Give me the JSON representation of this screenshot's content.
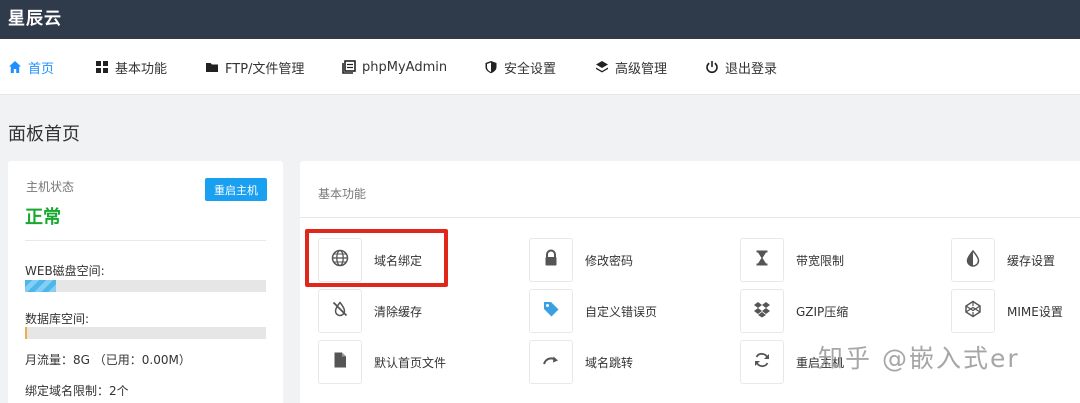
{
  "brand": "星辰云",
  "nav": {
    "items": [
      {
        "label": "首页",
        "icon": "home-icon",
        "active": true
      },
      {
        "label": "基本功能",
        "icon": "grid-icon"
      },
      {
        "label": "FTP/文件管理",
        "icon": "folder-icon"
      },
      {
        "label": "phpMyAdmin",
        "icon": "database-icon"
      },
      {
        "label": "安全设置",
        "icon": "shield-icon"
      },
      {
        "label": "高级管理",
        "icon": "layers-icon"
      },
      {
        "label": "退出登录",
        "icon": "power-icon"
      }
    ]
  },
  "page_title": "面板首页",
  "host": {
    "label": "主机状态",
    "status": "正常",
    "status_color": "#16a82f",
    "restart_label": "重启主机",
    "web_disk_label": "WEB磁盘空间:",
    "web_disk_fraction": 0.13,
    "db_label": "数据库空间:",
    "db_fraction": 0.01,
    "traffic": "月流量：8G （已用：0.00M）",
    "domain_limit": "绑定域名限制：2个"
  },
  "functions": {
    "title": "基本功能",
    "items": [
      {
        "label": "域名绑定",
        "icon": "globe-icon"
      },
      {
        "label": "修改密码",
        "icon": "lock-icon"
      },
      {
        "label": "带宽限制",
        "icon": "hourglass-icon"
      },
      {
        "label": "缓存设置",
        "icon": "contrast-icon"
      },
      {
        "label": "清除缓存",
        "icon": "slash-icon"
      },
      {
        "label": "自定义错误页",
        "icon": "tag-icon"
      },
      {
        "label": "GZIP压缩",
        "icon": "dropbox-icon"
      },
      {
        "label": "MIME设置",
        "icon": "codepen-icon"
      },
      {
        "label": "默认首页文件",
        "icon": "file-icon"
      },
      {
        "label": "域名跳转",
        "icon": "redirect-icon"
      },
      {
        "label": "重启主机",
        "icon": "refresh-icon"
      }
    ]
  },
  "watermark": "知乎 @嵌入式er",
  "colors": {
    "topbar": "#2f3a4a",
    "accent": "#1e90ff",
    "button": "#1aa0f0",
    "highlight": "#e1261c"
  }
}
